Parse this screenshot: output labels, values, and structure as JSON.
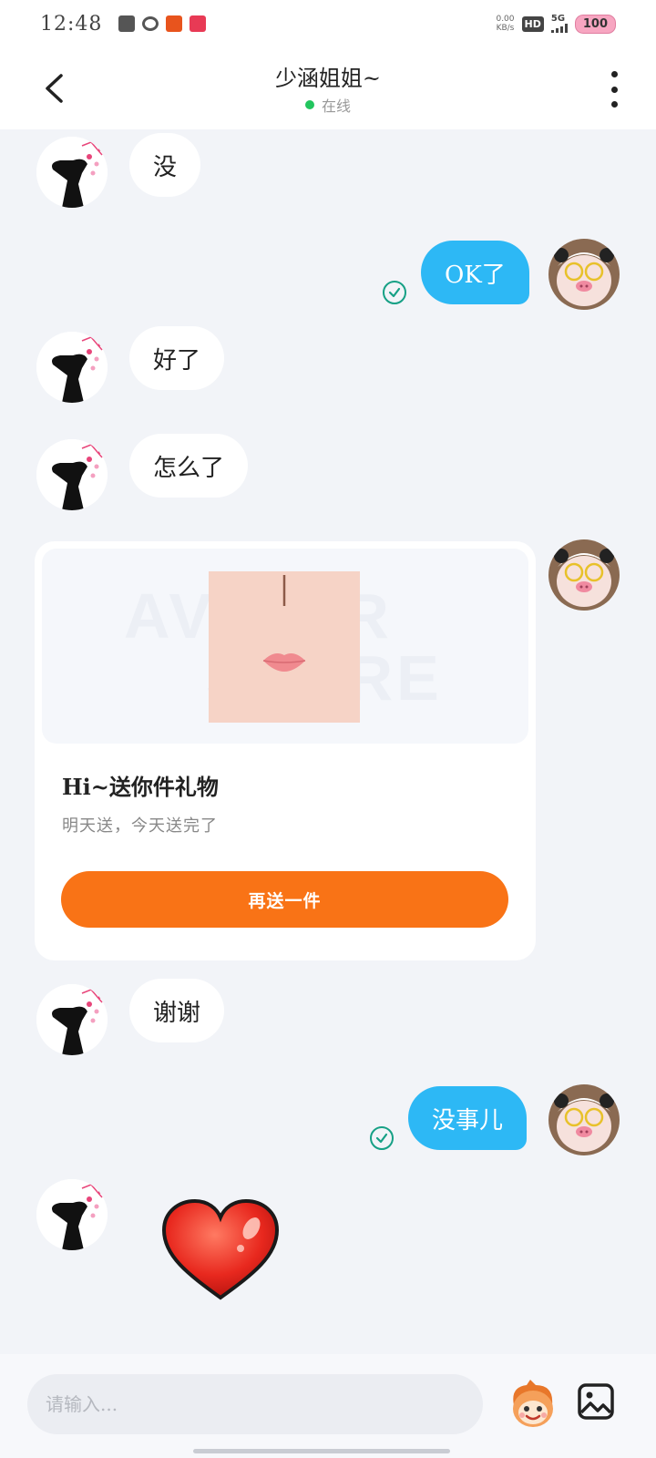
{
  "status_bar": {
    "time": "12:48",
    "net_speed_value": "0.00",
    "net_speed_unit": "KB/s",
    "hd": "HD",
    "network": "5G",
    "battery": "100"
  },
  "header": {
    "title": "少涵姐姐~",
    "status": "在线",
    "status_color": "#22c55e"
  },
  "messages": [
    {
      "side": "in",
      "text": "没"
    },
    {
      "side": "out",
      "text": "OK了",
      "read": true
    },
    {
      "side": "in",
      "text": "好了"
    },
    {
      "side": "in",
      "text": "怎么了"
    },
    {
      "side": "out",
      "type": "gift"
    },
    {
      "side": "in",
      "text": "谢谢"
    },
    {
      "side": "out",
      "text": "没事儿",
      "read": true
    },
    {
      "side": "in",
      "type": "sticker",
      "sticker": "heart-sticker"
    }
  ],
  "gift_card": {
    "watermark_line1": "AVATAR",
    "watermark_line2": "STORE",
    "title": "Hi~送你件礼物",
    "subtitle": "明天送，今天送完了",
    "button_label": "再送一件"
  },
  "input": {
    "placeholder": "请输入..."
  },
  "colors": {
    "outgoing_bubble": "#2db8f5",
    "incoming_bubble": "#ffffff",
    "accent_button": "#f97316",
    "read_tick": "#16a085",
    "background": "#f2f4f8"
  }
}
